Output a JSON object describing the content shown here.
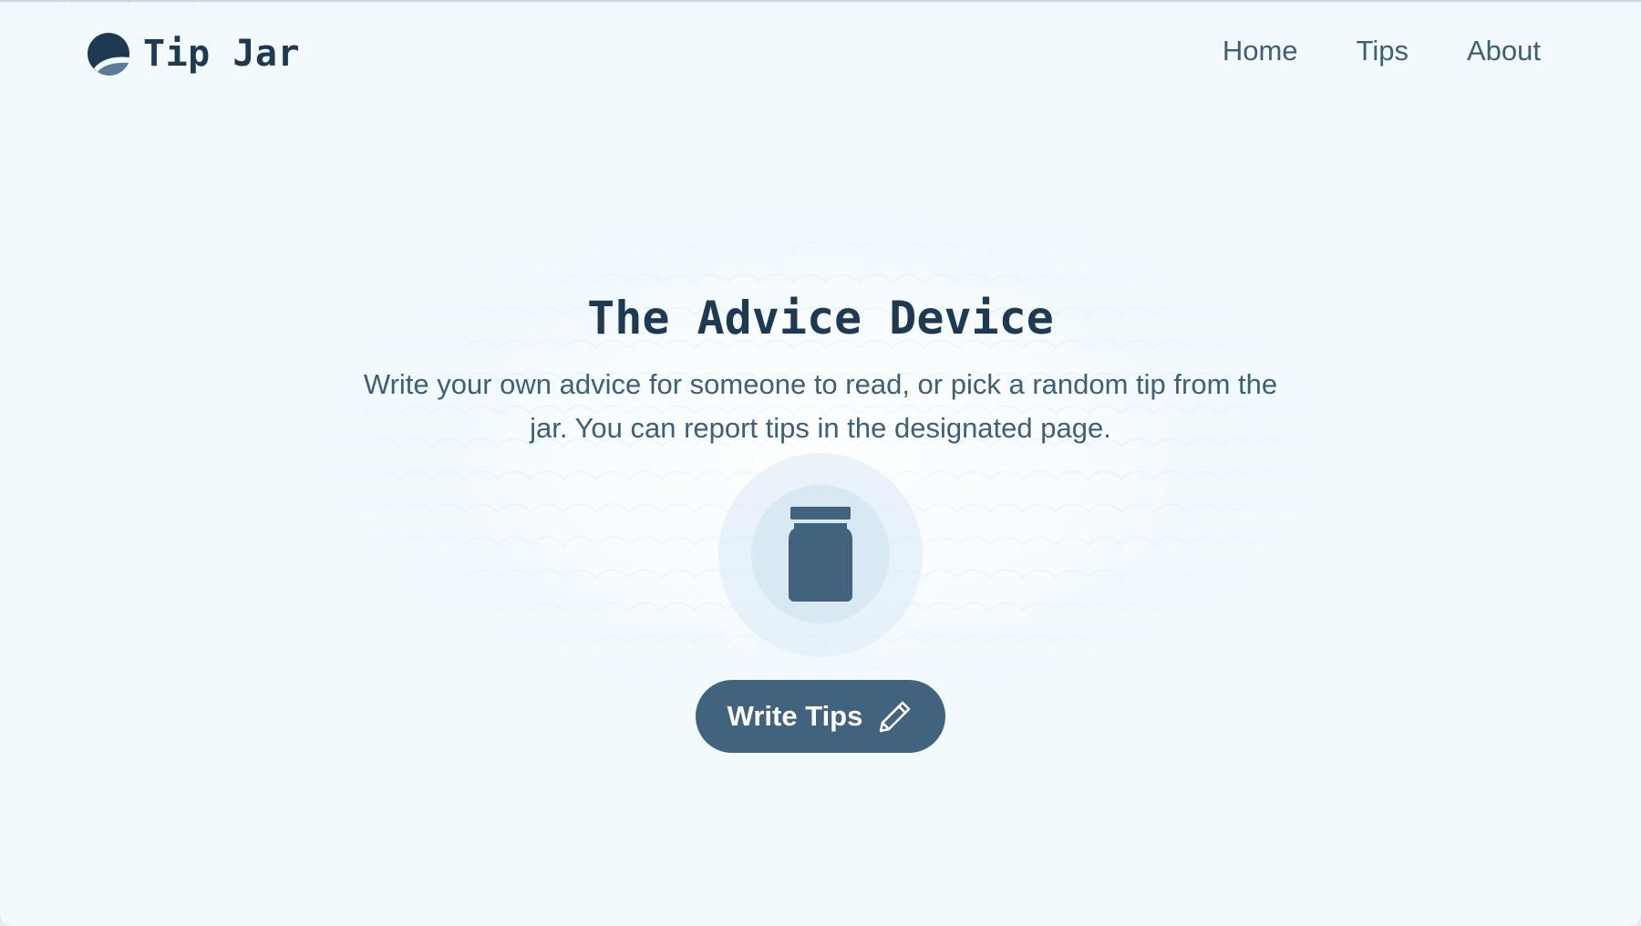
{
  "header": {
    "brand_name": "Tip Jar",
    "nav": [
      {
        "label": "Home"
      },
      {
        "label": "Tips"
      },
      {
        "label": "About"
      }
    ]
  },
  "hero": {
    "title": "The Advice Device",
    "description": "Write your own advice for someone to read, or pick a random tip from the jar. You can report tips in the designated page.",
    "button_label": "Write Tips",
    "jar_icon": "jar-icon",
    "button_icon": "pencil-icon"
  },
  "colors": {
    "background": "#f2fafe",
    "primary": "#42637d",
    "heading": "#1e3a52",
    "text": "#3e5f78",
    "jar_circle": "#d9e9f4"
  }
}
